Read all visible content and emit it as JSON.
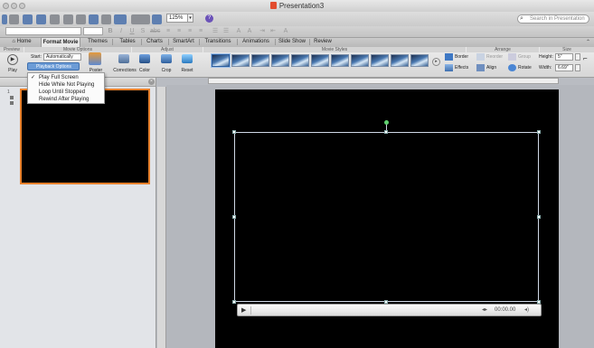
{
  "window": {
    "title": "Presentation3"
  },
  "toolbar": {
    "zoom": "125%",
    "search_placeholder": "Search in Presentation"
  },
  "tabs": [
    {
      "label": "Home",
      "icon": "home-icon"
    },
    {
      "label": "Format Movie",
      "active": true
    },
    {
      "label": "Themes"
    },
    {
      "label": "Tables"
    },
    {
      "label": "Charts"
    },
    {
      "label": "SmartArt"
    },
    {
      "label": "Transitions"
    },
    {
      "label": "Animations"
    },
    {
      "label": "Slide Show"
    },
    {
      "label": "Review"
    }
  ],
  "ribbon": {
    "groups": {
      "preview": "Preview",
      "movie_options": "Movie Options",
      "adjust": "Adjust",
      "movie_styles": "Movie Styles",
      "arrange": "Arrange",
      "size": "Size"
    },
    "play_label": "Play",
    "start_label": "Start:",
    "start_value": "Automatically",
    "playback_options": "Playback Options",
    "poster_frame": "Poster Frame",
    "corrections": "Corrections",
    "color": "Color",
    "crop": "Crop",
    "reset": "Reset",
    "border": "Border",
    "effects": "Effects",
    "reorder": "Reorder",
    "group": "Group",
    "align": "Align",
    "rotate": "Rotate",
    "height_label": "Height:",
    "height_value": "5\"",
    "width_label": "Width:",
    "width_value": "6.69\""
  },
  "playback_menu": {
    "items": [
      {
        "label": "Play Full Screen",
        "checked": true
      },
      {
        "label": "Hide While Not Playing",
        "checked": false
      },
      {
        "label": "Loop Until Stopped",
        "checked": false
      },
      {
        "label": "Rewind After Playing",
        "checked": false
      }
    ]
  },
  "slides_pane": {
    "slide_number": "1"
  },
  "player": {
    "time": "00:00.00"
  },
  "colors": {
    "thumb_border": "#e8802b",
    "slide_bg": "#000000",
    "accent": "#5e7fb1"
  }
}
